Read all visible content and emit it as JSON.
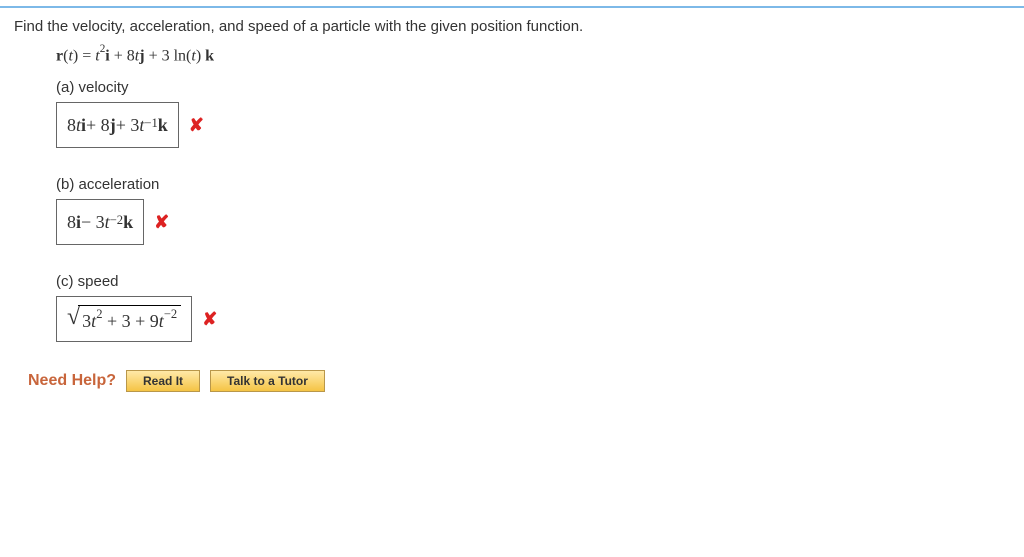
{
  "question": "Find the velocity, acceleration, and speed of a particle with the given position function.",
  "position_prefix": "r",
  "position_var": "(t) = ",
  "parts": {
    "a": {
      "label": "(a) velocity"
    },
    "b": {
      "label": "(b) acceleration"
    },
    "c": {
      "label": "(c) speed"
    }
  },
  "answers": {
    "a": {
      "status": "wrong"
    },
    "b": {
      "status": "wrong"
    },
    "c": {
      "status": "wrong"
    }
  },
  "wrong_mark": "✘",
  "help": {
    "label": "Need Help?",
    "read": "Read It",
    "tutor": "Talk to a Tutor"
  }
}
